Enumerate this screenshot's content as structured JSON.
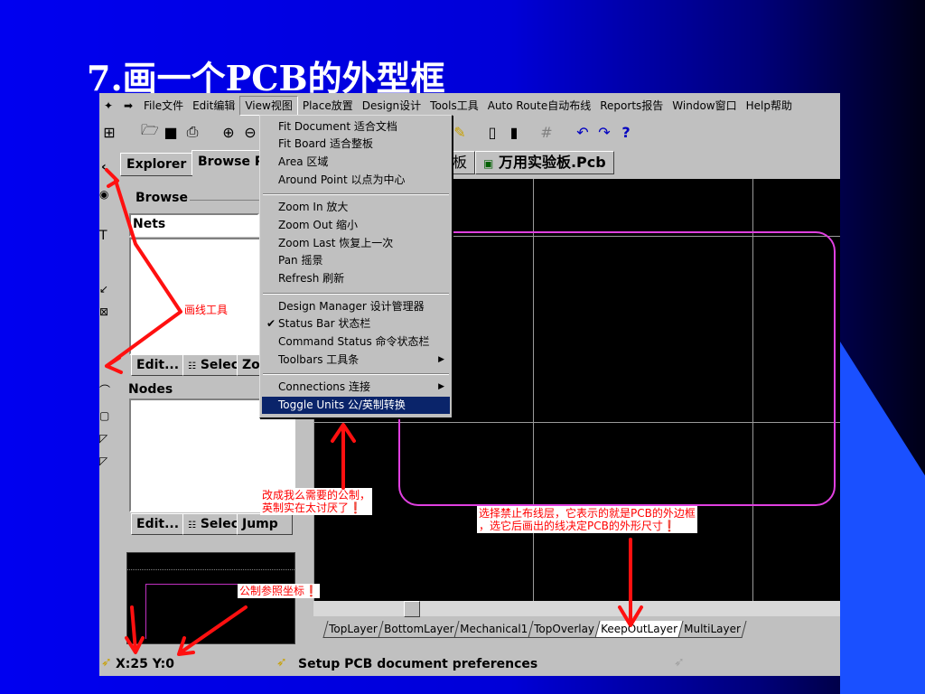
{
  "slide": {
    "title": "7.画一个PCB的外型框"
  },
  "menubar": {
    "items": [
      "File文件",
      "Edit编辑",
      "View视图",
      "Place放置",
      "Design设计",
      "Tools工具",
      "Auto Route自动布线",
      "Reports报告",
      "Window窗口",
      "Help帮助"
    ],
    "active": "View视图"
  },
  "view_menu": {
    "items": [
      {
        "label": "Fit Document 适合文档"
      },
      {
        "label": "Fit Board 适合整板"
      },
      {
        "label": "Area 区域"
      },
      {
        "label": "Around Point 以点为中心"
      },
      {
        "label": "Zoom In 放大"
      },
      {
        "label": "Zoom Out  缩小"
      },
      {
        "label": "Zoom Last 恢复上一次"
      },
      {
        "label": "Pan 摇景"
      },
      {
        "label": "Refresh  刷新"
      },
      {
        "label": "Design Manager 设计管理器"
      },
      {
        "label": "Status Bar 状态栏",
        "checked": true
      },
      {
        "label": "Command Status 命令状态栏"
      },
      {
        "label": "Toolbars 工具条",
        "submenu": true
      },
      {
        "label": "Connections 连接",
        "submenu": true
      },
      {
        "label": "Toggle Units 公/英制转换",
        "highlighted": true
      }
    ],
    "check_mark": "✔",
    "submenu_arrow": "▶"
  },
  "panel": {
    "tab_explorer": "Explorer",
    "tab_browse": "Browse P",
    "browse_group": "Browse",
    "browse_select": "Nets",
    "edit_label": "Edit...",
    "select_label": "Selec",
    "zoom_label": "Zo",
    "nodes_label": "Nodes",
    "edit2_label": "Edit...",
    "select2_label": "Selec",
    "jump_label": "Jump"
  },
  "doc_tabs": {
    "tab1": "板",
    "tab2": "万用实验板.Pcb"
  },
  "layers": [
    "TopLayer",
    "BottomLayer",
    "Mechanical1",
    "TopOverlay",
    "KeepOutLayer",
    "MultiLayer"
  ],
  "active_layer": "KeepOutLayer",
  "status": {
    "coords": "X:25 Y:0",
    "message": "Setup PCB document preferences"
  },
  "annotations": {
    "draw_tool": "画线工具",
    "units_note_1": "改成我么需要的公制，",
    "units_note_2": "英制实在太讨厌了❗",
    "layer_note_1": "选择禁止布线层，它表示的就是PCB的外边框",
    "layer_note_2": "，选它后画出的线决定PCB的外形尺寸❗",
    "coord_note": "公制参照坐标❗"
  },
  "colors": {
    "board_outline": "#e040e0",
    "annotation": "#ff0000",
    "menu_highlight": "#0a246a"
  }
}
